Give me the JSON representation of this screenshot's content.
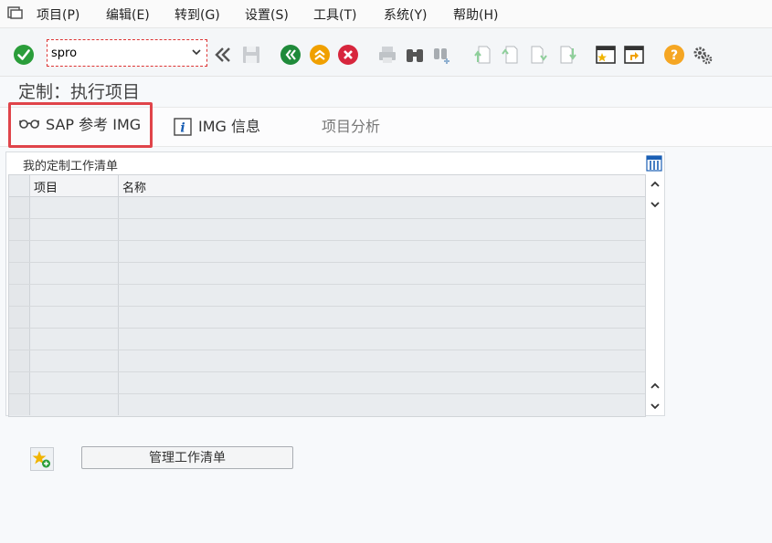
{
  "menu": {
    "items": [
      {
        "label": "项目(P)"
      },
      {
        "label": "编辑(E)"
      },
      {
        "label": "转到(G)"
      },
      {
        "label": "设置(S)"
      },
      {
        "label": "工具(T)"
      },
      {
        "label": "系统(Y)"
      },
      {
        "label": "帮助(H)"
      }
    ]
  },
  "toolbar": {
    "command_value": "spro"
  },
  "page": {
    "title": "定制：执行项目"
  },
  "appbar": {
    "sap_ref_img": "SAP 参考 IMG",
    "img_info": "IMG 信息",
    "project_analysis": "项目分析"
  },
  "worklist": {
    "title": "我的定制工作清单",
    "columns": [
      "项目",
      "名称"
    ],
    "rows": [
      [
        "",
        ""
      ],
      [
        "",
        ""
      ],
      [
        "",
        ""
      ],
      [
        "",
        ""
      ],
      [
        "",
        ""
      ],
      [
        "",
        ""
      ],
      [
        "",
        ""
      ],
      [
        "",
        ""
      ],
      [
        "",
        ""
      ],
      [
        "",
        ""
      ]
    ]
  },
  "bottom": {
    "manage_label": "管理工作清单"
  },
  "colors": {
    "confirm_green": "#2a9d3a",
    "nav_back_green": "#1f8a3a",
    "nav_up_orange": "#f0a000",
    "cancel_red": "#d7263d",
    "help_orange": "#f5a623",
    "highlight_red": "#e0444a"
  }
}
